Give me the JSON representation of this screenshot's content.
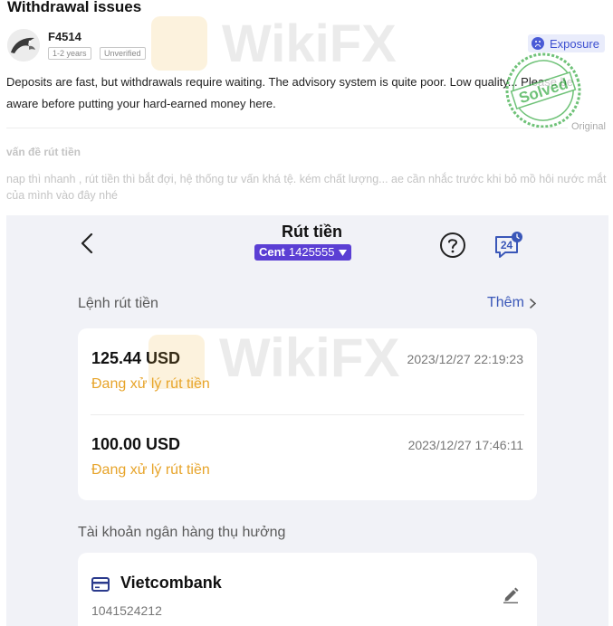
{
  "post": {
    "title": "Withdrawal issues",
    "user": {
      "name": "F4514",
      "tags": [
        "1-2 years",
        "Unverified"
      ]
    },
    "badge": {
      "label": "Exposure",
      "icon": "sad-face-icon"
    },
    "text": "Deposits are fast, but withdrawals require waiting. The advisory system is quite poor. Low quality... Please be aware before putting your hard-earned money here.",
    "stamp_label": "Solved",
    "original_label": "Original",
    "original_title": "vấn đề rút tiền",
    "original_text": "nap thì nhanh , rút tiền thì bắt đợi, hệ thống tư vấn khá tệ. kém chất lượng... ae cần nhắc trước khi bỏ mồ hôi nước mắt của mình vào đây nhé"
  },
  "watermark": "WikiFX",
  "app": {
    "title": "Rút tiền",
    "account_type": "Cent",
    "account_number": "1425555",
    "support_badge": "24",
    "withdraw_section_label": "Lệnh rút tiền",
    "more_label": "Thêm",
    "withdrawals": [
      {
        "amount": "125.44 USD",
        "datetime": "2023/12/27 22:19:23",
        "status": "Đang xử lý rút tiền"
      },
      {
        "amount": "100.00 USD",
        "datetime": "2023/12/27 17:46:11",
        "status": "Đang xử lý rút tiền"
      }
    ],
    "bank_section_label": "Tài khoản ngân hàng thụ hưởng",
    "bank": {
      "name": "Vietcombank",
      "account": "1041524212"
    }
  },
  "colors": {
    "accent_purple": "#5b3fd4",
    "status_orange": "#e7a42a",
    "link_blue": "#3a57b8",
    "stamp_green": "#3fae4b",
    "exposure_blue": "#3c4fd0"
  }
}
